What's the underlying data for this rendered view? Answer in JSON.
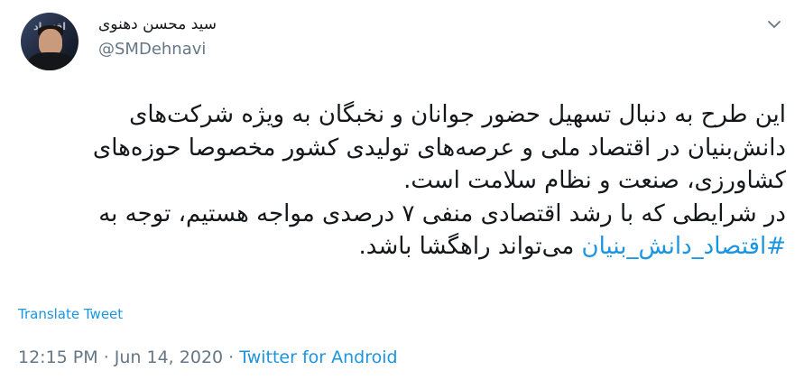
{
  "author": {
    "display_name": "سید محسن دهنوی",
    "handle": "@SMDehnavi",
    "avatar_banner_text": "اقتصاد دان"
  },
  "tweet": {
    "line1": "این طرح به دنبال تسهیل حضور جوانان و نخبگان به ویژه شرکت‌های",
    "line2": "دانش‌بنیان در اقتصاد ملی و عرصه‌های تولیدی کشور مخصوصا حوزه‌های",
    "line3": "کشاورزی، صنعت و نظام سلامت است.",
    "line4": "در شرایطی که با رشد اقتصادی منفی ۷ درصدی مواجه هستیم، توجه به",
    "line5_hashtag": "#اقتصاد_دانش_بنیان",
    "line5_rest": " می‌تواند راهگشا باشد."
  },
  "translate_label": "Translate Tweet",
  "meta": {
    "time": "12:15 PM",
    "separator": " · ",
    "date": "Jun 14, 2020",
    "source": "Twitter for Android"
  },
  "icons": {
    "menu": "chevron-down-icon"
  },
  "colors": {
    "link": "#1b95e0",
    "secondary": "#657786",
    "text": "#14171a"
  }
}
